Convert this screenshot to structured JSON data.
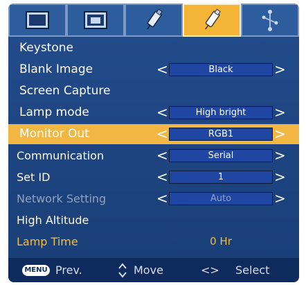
{
  "tabs": [
    {
      "icon": "picture-icon"
    },
    {
      "icon": "screen-icon"
    },
    {
      "icon": "usb-icon"
    },
    {
      "icon": "settings-plug-icon"
    },
    {
      "icon": "network-icon"
    }
  ],
  "active_tab_index": 3,
  "menu": [
    {
      "label": "Keystone"
    },
    {
      "label": "Blank Image",
      "value": "Black"
    },
    {
      "label": "Screen Capture"
    },
    {
      "label": "Lamp mode",
      "value": "High bright"
    },
    {
      "label": "Monitor Out",
      "value": "RGB1",
      "highlighted": true
    },
    {
      "label": "Communication",
      "value": "Serial"
    },
    {
      "label": "Set ID",
      "value": "1"
    },
    {
      "label": "Network Setting",
      "value": "Auto",
      "disabled": true
    },
    {
      "label": "High Altitude"
    },
    {
      "label": "Lamp Time",
      "value": "0 Hr"
    }
  ],
  "arrows": {
    "left": "<",
    "right": ">"
  },
  "footer": {
    "menu_key": "MENU",
    "prev": "Prev.",
    "move_icon": "up-down-arrows-icon",
    "move": "Move",
    "select_arrows": "<>",
    "select": "Select"
  },
  "colors": {
    "highlight": "#f2b642",
    "panel": "#1a3f78",
    "value_box": "#1f46a2",
    "gold_text": "#f5bb48"
  }
}
